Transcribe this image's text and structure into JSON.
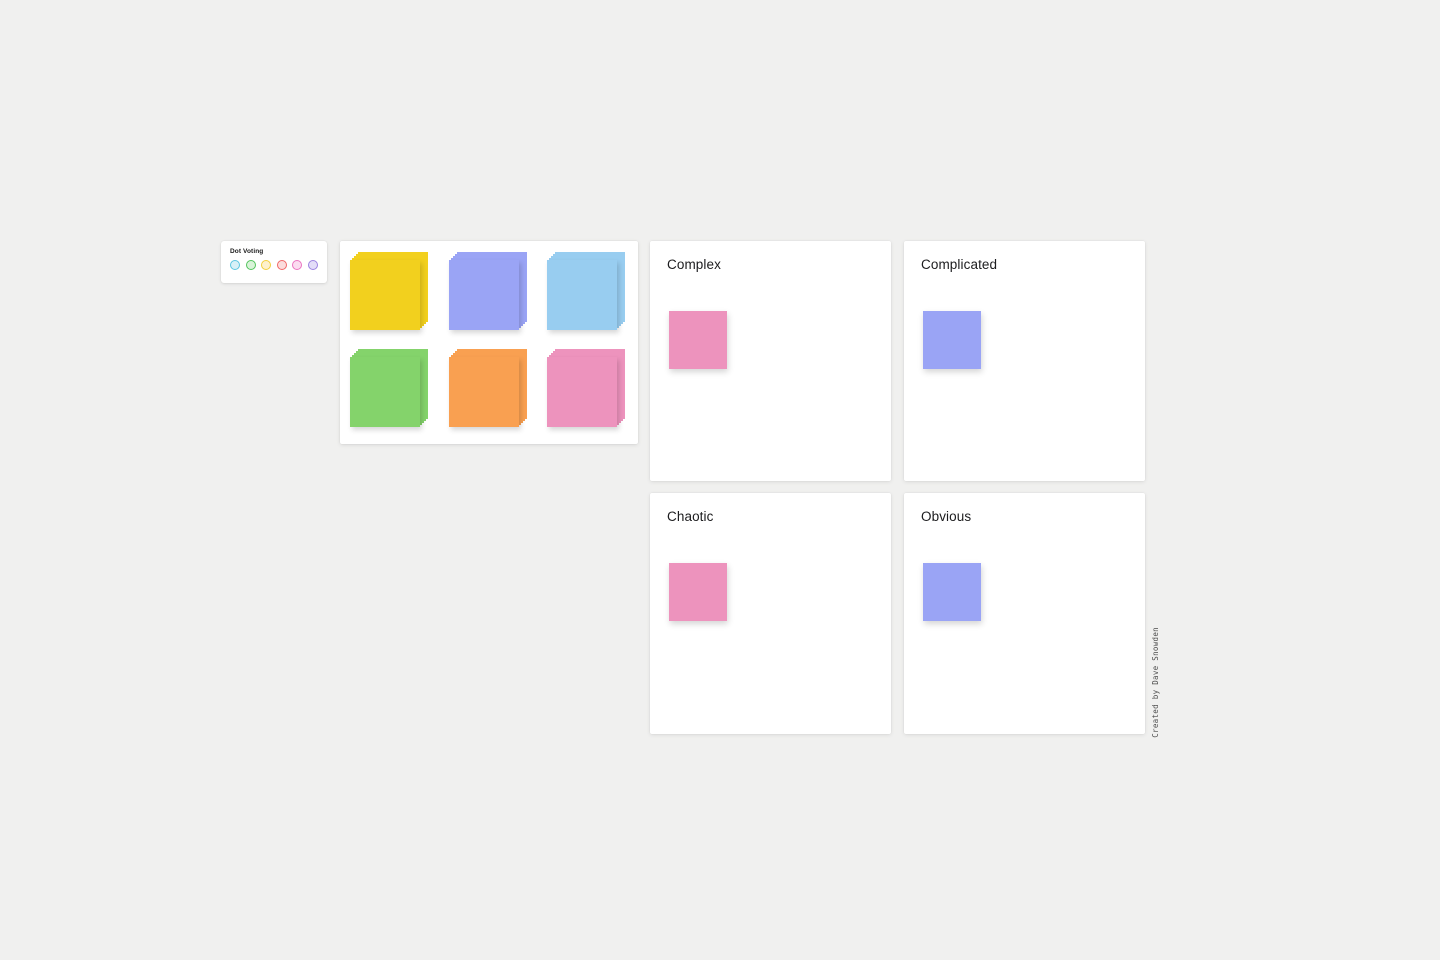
{
  "canvas": {
    "background_color": "#f0f0ef"
  },
  "dot_voting": {
    "title": "Dot Voting",
    "dots": [
      {
        "name": "dot-blue",
        "fill": "#d8f0f7",
        "ring": "#5cc5e0"
      },
      {
        "name": "dot-green",
        "fill": "#d8f3d8",
        "ring": "#52c45c"
      },
      {
        "name": "dot-yellow",
        "fill": "#fdf1cd",
        "ring": "#f2cf3c"
      },
      {
        "name": "dot-red",
        "fill": "#fbdcdc",
        "ring": "#f06767"
      },
      {
        "name": "dot-pink",
        "fill": "#fbdcf0",
        "ring": "#ea74c0"
      },
      {
        "name": "dot-purple",
        "fill": "#e3ddf8",
        "ring": "#9b82e0"
      }
    ]
  },
  "sticky_palette": {
    "notes": [
      {
        "name": "sticky-yellow",
        "color": "#f2d01e"
      },
      {
        "name": "sticky-purple",
        "color": "#9aa4f5"
      },
      {
        "name": "sticky-blue",
        "color": "#98cdf0"
      },
      {
        "name": "sticky-green",
        "color": "#84d36b"
      },
      {
        "name": "sticky-orange",
        "color": "#f9a051"
      },
      {
        "name": "sticky-pink",
        "color": "#ed93bd"
      }
    ]
  },
  "quadrants": [
    {
      "name": "complex",
      "title": "Complex",
      "note_color": "#ed93bd"
    },
    {
      "name": "complicated",
      "title": "Complicated",
      "note_color": "#9aa4f5"
    },
    {
      "name": "chaotic",
      "title": "Chaotic",
      "note_color": "#ed93bd"
    },
    {
      "name": "obvious",
      "title": "Obvious",
      "note_color": "#9aa4f5"
    }
  ],
  "attribution": {
    "text": "Created by Dave Snowden"
  }
}
